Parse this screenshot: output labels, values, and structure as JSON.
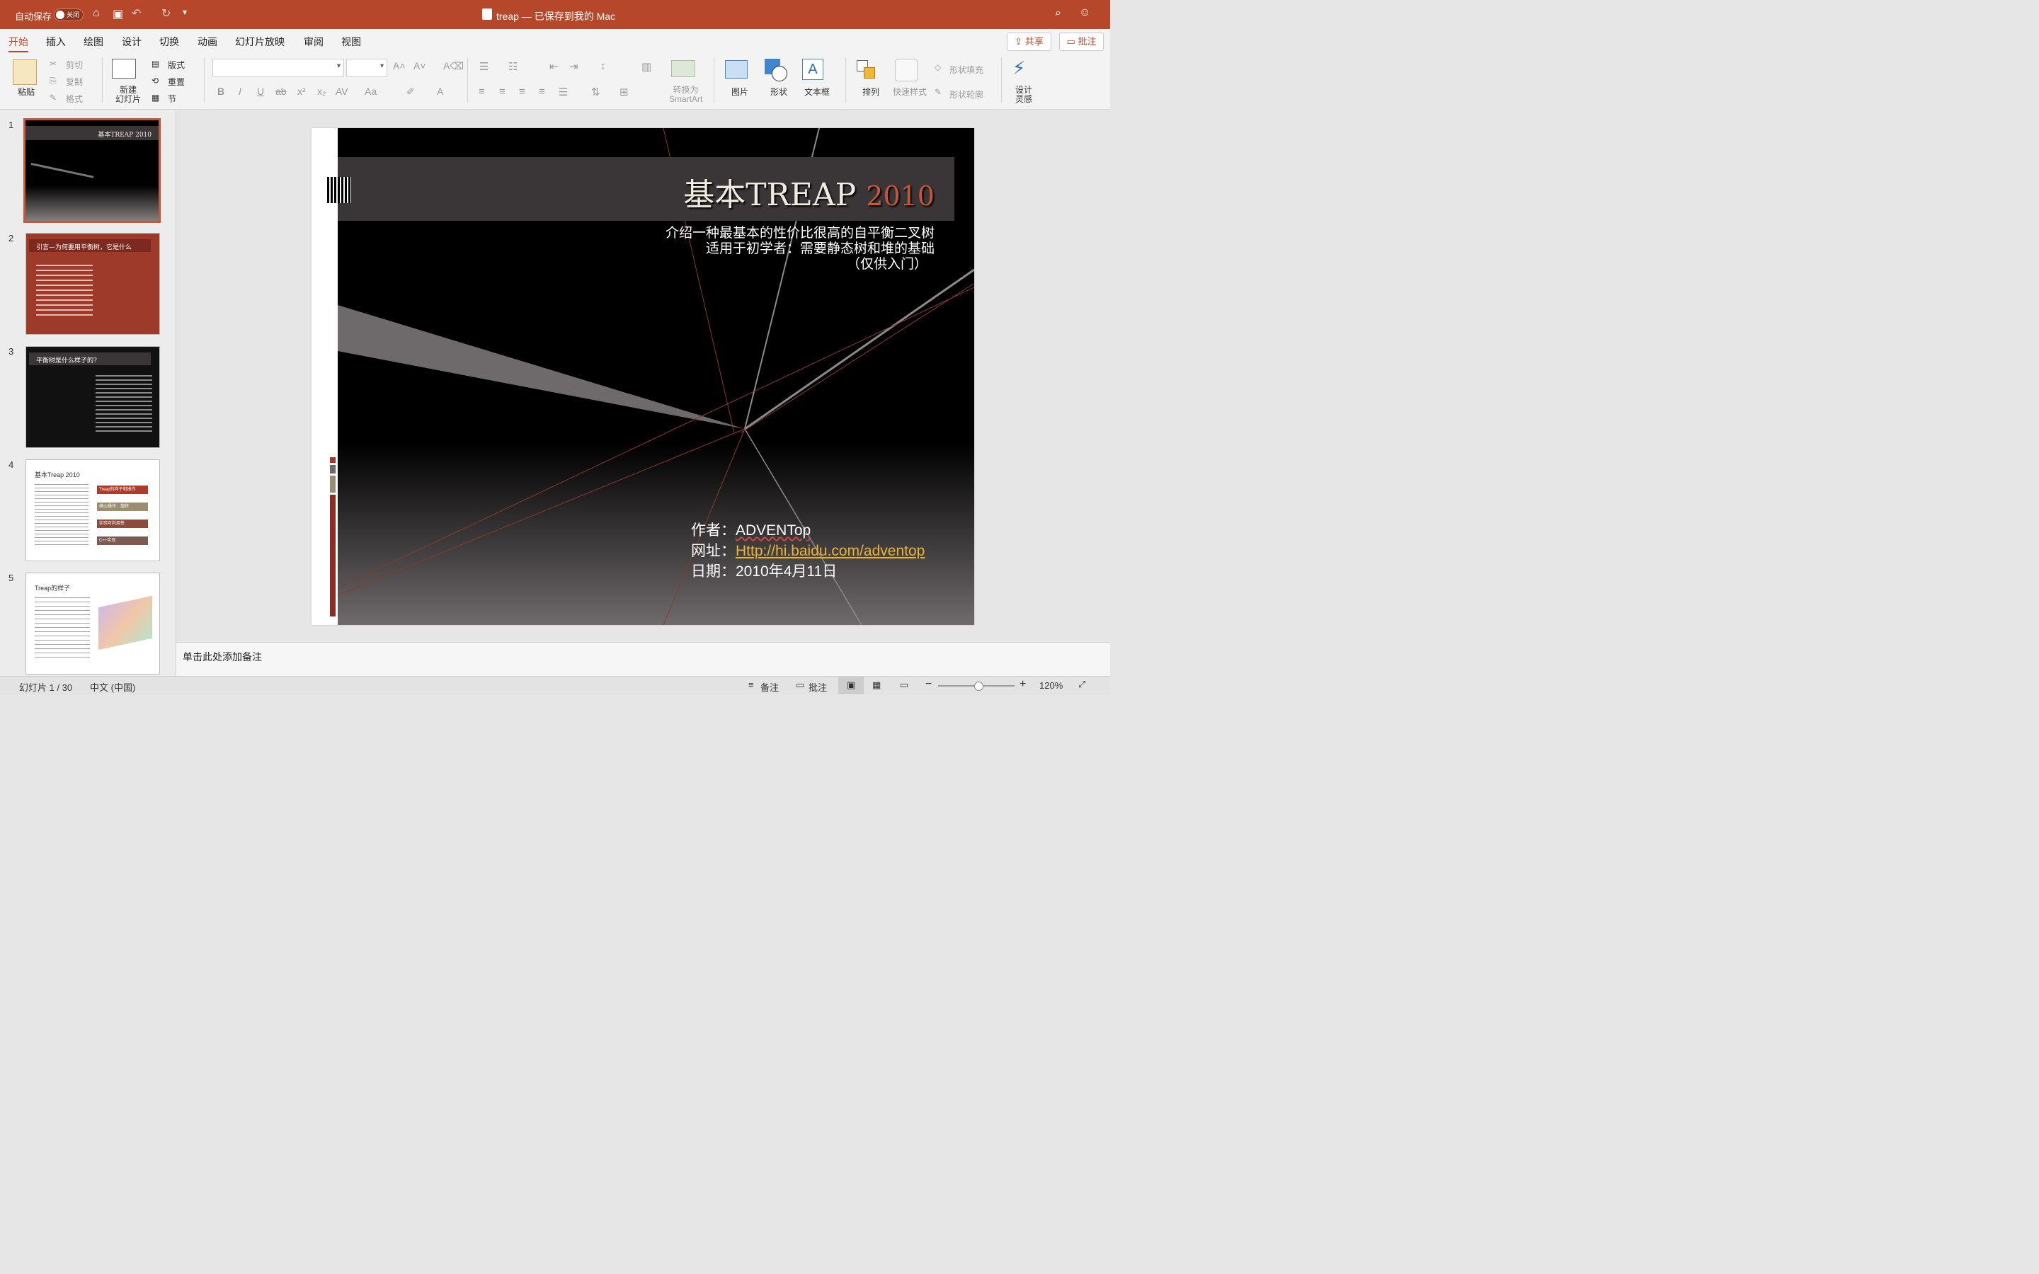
{
  "titlebar": {
    "autosave_label": "自动保存",
    "autosave_state": "关闭",
    "doc_title": "treap — 已保存到我的 Mac"
  },
  "tabs": [
    "开始",
    "插入",
    "绘图",
    "设计",
    "切换",
    "动画",
    "幻灯片放映",
    "审阅",
    "视图"
  ],
  "actions": {
    "share": "共享",
    "comment": "批注"
  },
  "ribbon": {
    "paste": "粘贴",
    "cut": "剪切",
    "copy": "复制",
    "format": "格式",
    "new_slide": "新建\n幻灯片",
    "layout": "版式",
    "reset": "重置",
    "section": "节",
    "convert_smartart": "转换为\nSmartArt",
    "picture": "图片",
    "shape": "形状",
    "textbox": "文本框",
    "arrange": "排列",
    "quick_styles": "快速样式",
    "shape_fill": "形状填充",
    "shape_outline": "形状轮廓",
    "design_ideas": "设计\n灵感"
  },
  "thumbnails": [
    {
      "num": "1",
      "title": "基本TREAP 2010"
    },
    {
      "num": "2",
      "title": "引言—为何要用平衡树，它是什么"
    },
    {
      "num": "3",
      "title": "平衡树是什么样子的?"
    },
    {
      "num": "4",
      "title": "基本Treap 2010",
      "items": [
        "Treap的样子和操作",
        "核心操作：旋转",
        "实验可利用性",
        "C++实现"
      ]
    },
    {
      "num": "5",
      "title": "Treap的样子"
    }
  ],
  "slide": {
    "title_main": "基本TREAP",
    "title_year": "2010",
    "subtitle_lines": [
      "介绍一种最基本的性价比很高的自平衡二叉树",
      "适用于初学者：需要静态树和堆的基础",
      "（仅供入门）"
    ],
    "author_label": "作者：",
    "author": "ADVENTop",
    "url_label": "网址：",
    "url": "Http://hi.baidu.com/adventop",
    "date_label": "日期：",
    "date": "2010年4月11日"
  },
  "notes_placeholder": "单击此处添加备注",
  "status": {
    "slide_index": "幻灯片 1 / 30",
    "language": "中文 (中国)",
    "notes": "备注",
    "comments": "批注",
    "zoom": "120%"
  },
  "colors": {
    "accent": "#b7472a",
    "slide_bg": "#000000",
    "title_bar": "#3a3536"
  }
}
